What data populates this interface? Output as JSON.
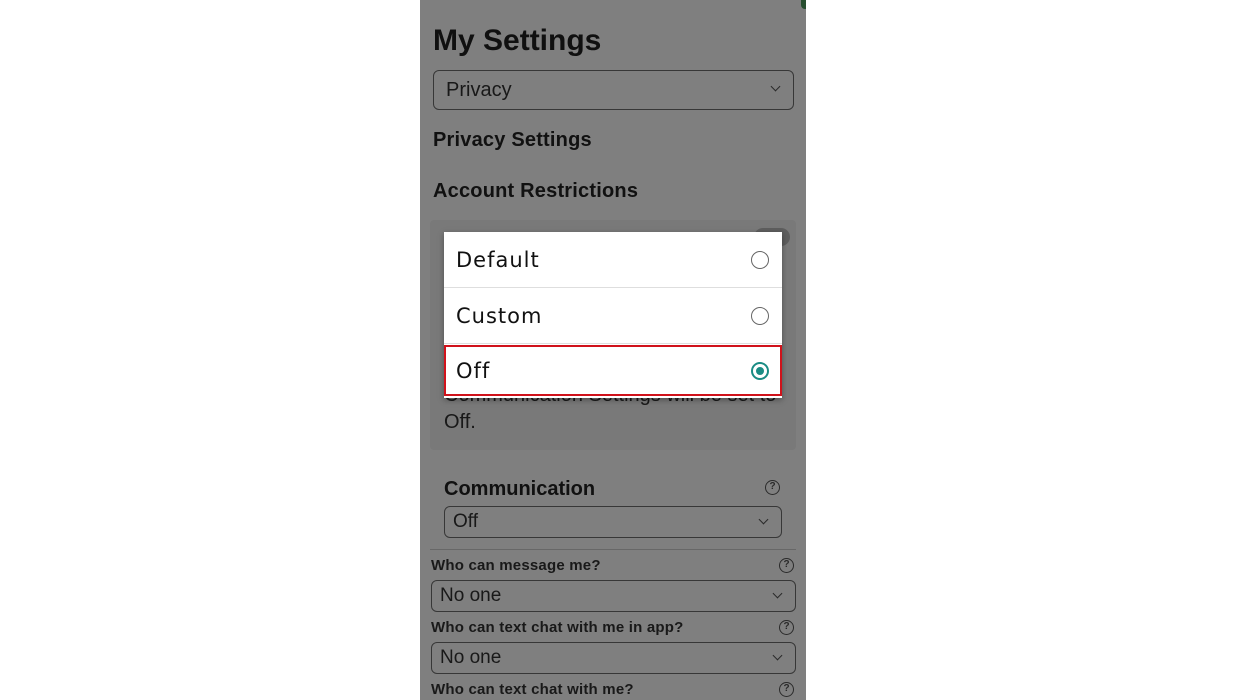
{
  "page": {
    "title": "My Settings",
    "category_select": {
      "value": "Privacy"
    },
    "privacy_heading": "Privacy Settings",
    "restrictions_heading": "Account Restrictions",
    "restriction_note": "Communication Settings will be set to Off.",
    "communication": {
      "title": "Communication",
      "value": "Off"
    },
    "questions": [
      {
        "label": "Who can message me?",
        "value": "No one"
      },
      {
        "label": "Who can text chat with me in app?",
        "value": "No one"
      },
      {
        "label": "Who can text chat with me?",
        "value": ""
      }
    ],
    "help_glyph": "?"
  },
  "dialog": {
    "options": [
      {
        "label": "Default",
        "selected": false
      },
      {
        "label": "Custom",
        "selected": false
      },
      {
        "label": "Off",
        "selected": true
      }
    ],
    "highlight_color": "#d0121b",
    "accent_color": "#1a8c84"
  }
}
